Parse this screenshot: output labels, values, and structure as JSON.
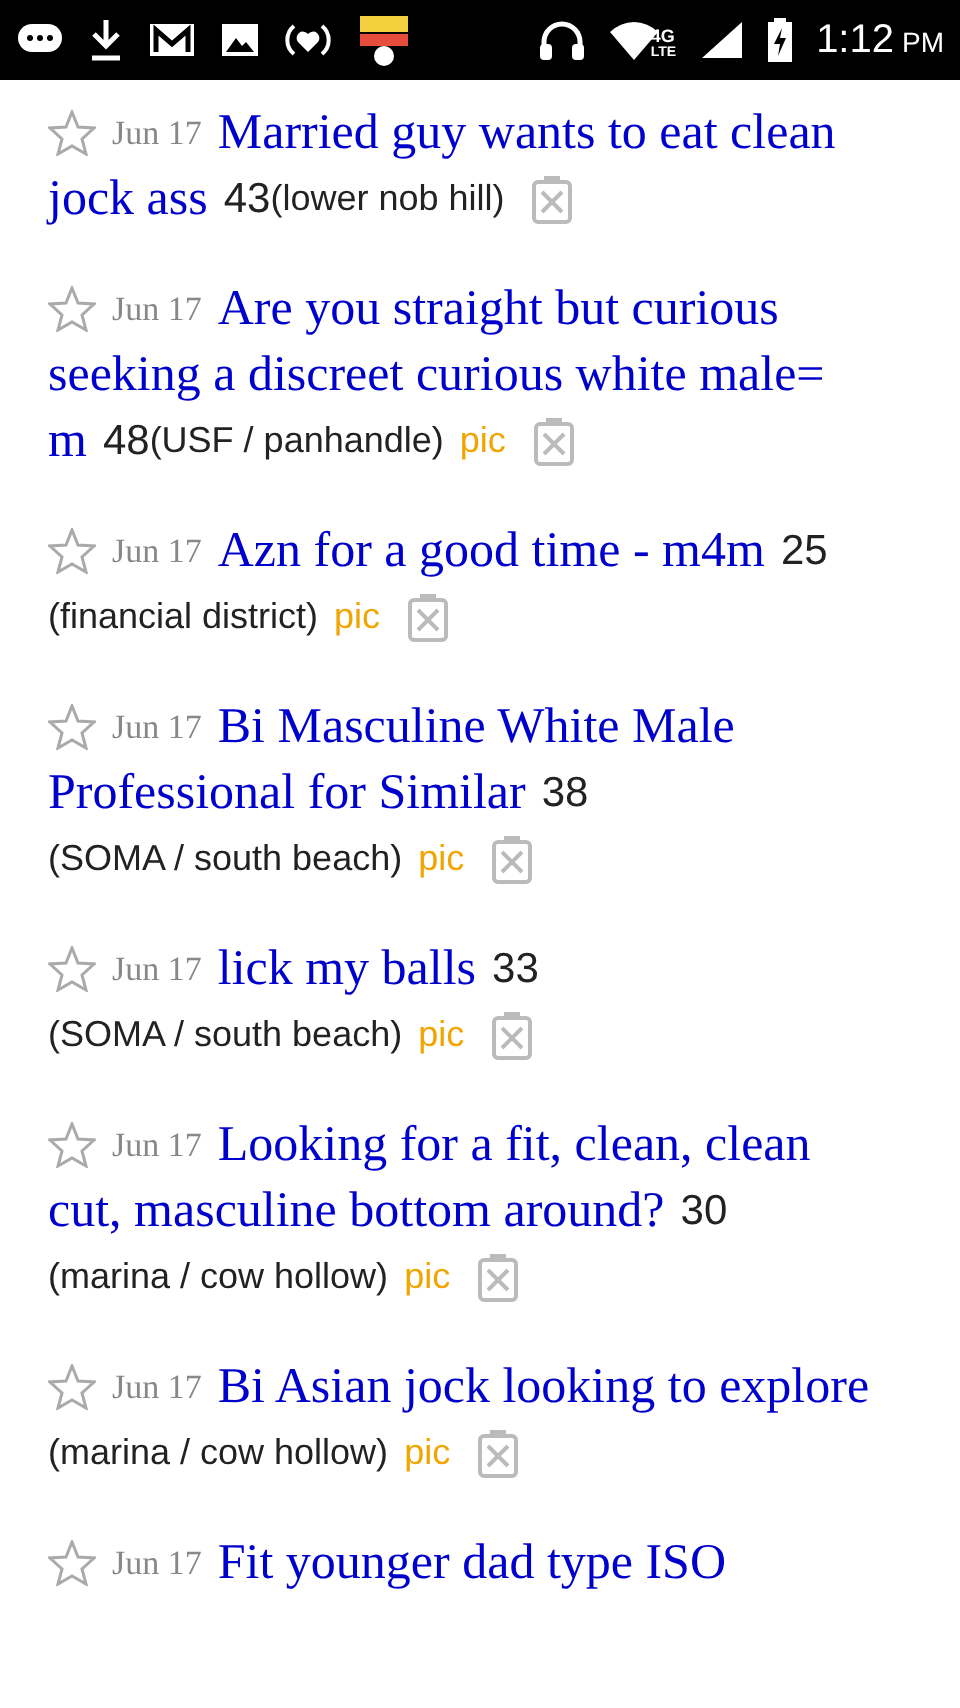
{
  "status_bar": {
    "network_top": "4G",
    "network_bottom": "LTE",
    "time": "1:12",
    "time_suffix": "PM"
  },
  "listings": [
    {
      "date": "Jun 17",
      "title_lines": [
        "Married guy wants to eat clean",
        "jock ass"
      ],
      "price": "43",
      "location": "(lower nob hill)"
    },
    {
      "date": "Jun 17",
      "title_lines": [
        "Are you straight but curious",
        "seeking a discreet curious white male=",
        "m"
      ],
      "price": "48",
      "location": "(USF / panhandle)",
      "pic": "pic"
    },
    {
      "date": "Jun 17",
      "title_lines": [
        "Azn for a good time - m4m"
      ],
      "price": "25",
      "location": "(financial district)",
      "pic": "pic"
    },
    {
      "date": "Jun 17",
      "title_lines": [
        "Bi Masculine White Male",
        "Professional for Similar"
      ],
      "price": "38",
      "location": "(SOMA / south beach)",
      "pic": "pic"
    },
    {
      "date": "Jun 17",
      "title_lines": [
        "lick my balls"
      ],
      "price": "33",
      "location": "(SOMA / south beach)",
      "pic": "pic"
    },
    {
      "date": "Jun 17",
      "title_lines": [
        "Looking for a fit, clean, clean",
        "cut, masculine bottom around?"
      ],
      "price": "30",
      "location": "(marina / cow hollow)",
      "pic": "pic"
    },
    {
      "date": "Jun 17",
      "title_lines": [
        "Bi Asian jock looking to explore"
      ],
      "location": "(marina / cow hollow)",
      "pic": "pic"
    },
    {
      "date": "Jun 17",
      "title_lines": [
        "Fit younger dad type ISO"
      ]
    }
  ]
}
